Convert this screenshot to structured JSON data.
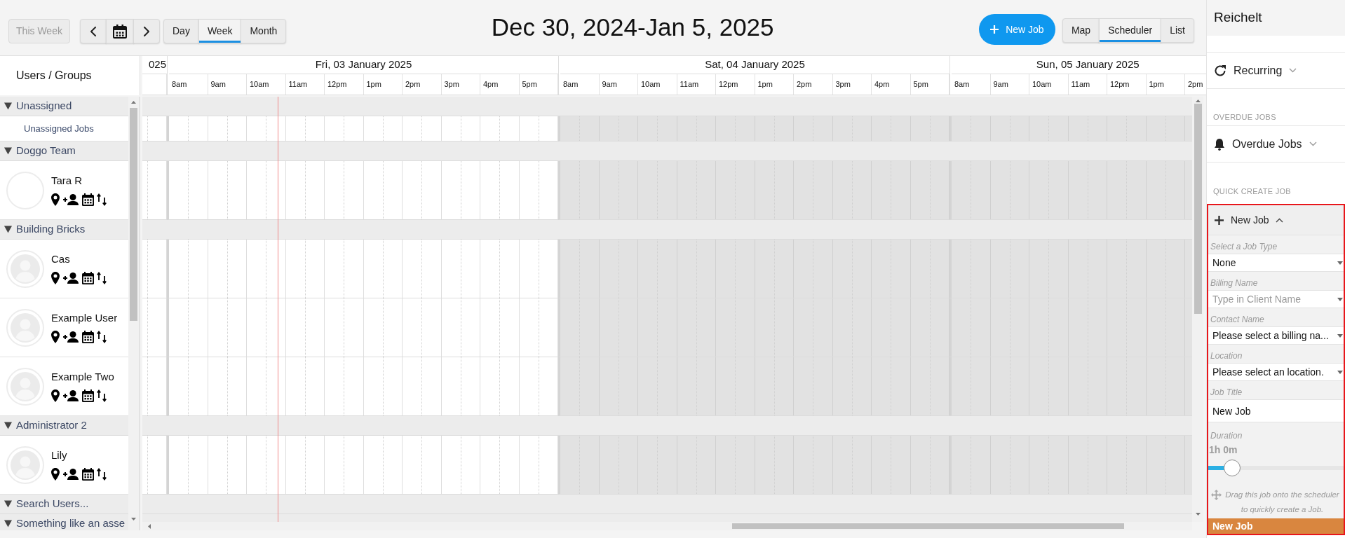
{
  "toolbar": {
    "this_week": {
      "label": "This Week",
      "disabled": true
    },
    "views": [
      {
        "label": "Day",
        "selected": false
      },
      {
        "label": "Week",
        "selected": true
      },
      {
        "label": "Month",
        "selected": false
      }
    ],
    "title": "Dec 30, 2024-Jan 5, 2025",
    "new_job": "New Job",
    "modes": [
      {
        "label": "Map",
        "selected": false
      },
      {
        "label": "Scheduler",
        "selected": true
      },
      {
        "label": "List",
        "selected": false
      }
    ]
  },
  "sidebar": {
    "heading": "Users / Groups",
    "groups": [
      {
        "name": "Unassigned",
        "expanded": true,
        "members": [
          {
            "kind": "label",
            "name": "Unassigned Jobs"
          }
        ]
      },
      {
        "name": "Doggo Team",
        "expanded": true,
        "members": [
          {
            "kind": "user",
            "name": "Tara R",
            "silhouette": false
          }
        ]
      },
      {
        "name": "Building Bricks",
        "expanded": true,
        "members": [
          {
            "kind": "user",
            "name": "Cas",
            "silhouette": true
          },
          {
            "kind": "user",
            "name": "Example User",
            "silhouette": true
          },
          {
            "kind": "user",
            "name": "Example Two",
            "silhouette": true
          }
        ]
      },
      {
        "name": "Administrator 2",
        "expanded": true,
        "members": [
          {
            "kind": "user",
            "name": "Lily",
            "silhouette": true
          }
        ]
      },
      {
        "name": "Search Users...",
        "expanded": true
      },
      {
        "name": "Something like an asse",
        "expanded": true
      }
    ]
  },
  "schedule": {
    "days": [
      {
        "label": "025",
        "weekend": false
      },
      {
        "label": "Fri, 03 January 2025",
        "weekend": false,
        "hours": [
          "8am",
          "9am",
          "10am",
          "11am",
          "12pm",
          "1pm",
          "2pm",
          "3pm",
          "4pm",
          "5pm"
        ],
        "now_line": {
          "level": 0.28
        }
      },
      {
        "label": "Sat, 04 January 2025",
        "weekend": true,
        "hours": [
          "8am",
          "9am",
          "10am",
          "11am",
          "12pm",
          "1pm",
          "2pm",
          "3pm",
          "4pm",
          "5pm"
        ]
      },
      {
        "label": "Sun, 05 January 2025",
        "weekend": true,
        "hours": [
          "8am",
          "9am",
          "10am",
          "11am",
          "12pm",
          "1pm",
          "2pm"
        ]
      }
    ]
  },
  "panel": {
    "title": "Reichelt",
    "sections": [
      {
        "rows": [
          {
            "kind": "recurring",
            "label": "Recurring",
            "expanded": false
          }
        ]
      },
      {
        "heading": "OVERDUE JOBS",
        "rows": [
          {
            "kind": "overdue",
            "label": "Overdue Jobs",
            "expanded": false
          }
        ]
      }
    ],
    "quick_create": {
      "heading": "QUICK CREATE JOB",
      "highlighted": true,
      "expanded": true,
      "title": "New Job",
      "fields": [
        {
          "kind": "select",
          "label": "Select a Job Type",
          "value": "None"
        },
        {
          "kind": "select",
          "label": "Billing Name",
          "placeholder": "Type in Client Name"
        },
        {
          "kind": "select",
          "label": "Contact Name",
          "value": "Please select a billing na..."
        },
        {
          "kind": "select",
          "label": "Location",
          "value": "Please select an location."
        },
        {
          "kind": "text",
          "label": "Job Title",
          "value": "New Job"
        }
      ],
      "duration": {
        "label": "Duration",
        "reading": "1h 0m",
        "level": 0.13
      },
      "hint": "Drag this job onto the scheduler to quickly create a Job.",
      "submit": "New Job"
    }
  }
}
